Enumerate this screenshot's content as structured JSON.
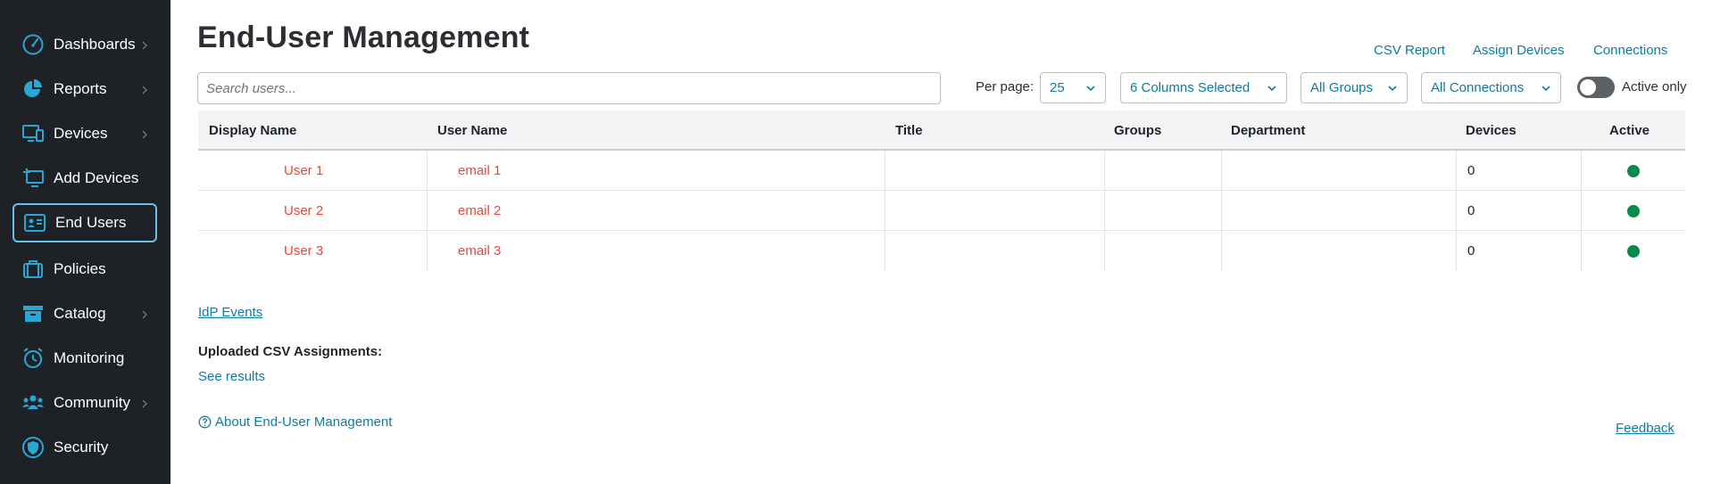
{
  "app": {
    "title": "End-User Management"
  },
  "sidebar": {
    "items": [
      {
        "label": "Dashboards",
        "icon": "dashboard-gauge-icon",
        "has_submenu": true
      },
      {
        "label": "Reports",
        "icon": "pie-chart-icon",
        "has_submenu": true
      },
      {
        "label": "Devices",
        "icon": "devices-icon",
        "has_submenu": true
      },
      {
        "label": "Add Devices",
        "icon": "add-device-icon",
        "has_submenu": false
      },
      {
        "label": "End Users",
        "icon": "id-card-icon",
        "has_submenu": false,
        "active": true
      },
      {
        "label": "Policies",
        "icon": "briefcase-icon",
        "has_submenu": false
      },
      {
        "label": "Catalog",
        "icon": "archive-box-icon",
        "has_submenu": true
      },
      {
        "label": "Monitoring",
        "icon": "alarm-clock-icon",
        "has_submenu": false
      },
      {
        "label": "Community",
        "icon": "people-icon",
        "has_submenu": true
      },
      {
        "label": "Security",
        "icon": "shield-icon",
        "has_submenu": false
      }
    ]
  },
  "header": {
    "links": {
      "csv_report": "CSV Report",
      "assign_devices": "Assign Devices",
      "connections": "Connections"
    }
  },
  "toolbar": {
    "search_placeholder": "Search users...",
    "per_page_label": "Per page:",
    "per_page_value": "25",
    "columns_select": "6 Columns Selected",
    "groups_select": "All Groups",
    "connections_select": "All Connections",
    "active_only_label": "Active only",
    "active_only_on": false
  },
  "table": {
    "columns": [
      "Display Name",
      "User Name",
      "Title",
      "Groups",
      "Department",
      "Devices",
      "Active"
    ],
    "rows": [
      {
        "display_name": "User 1",
        "user_name": "email 1",
        "title": "",
        "groups": "",
        "department": "",
        "devices": "0",
        "active": true
      },
      {
        "display_name": "User 2",
        "user_name": "email 2",
        "title": "",
        "groups": "",
        "department": "",
        "devices": "0",
        "active": true
      },
      {
        "display_name": "User 3",
        "user_name": "email 3",
        "title": "",
        "groups": "",
        "department": "",
        "devices": "0",
        "active": true
      }
    ]
  },
  "footer": {
    "idp_events": "IdP Events",
    "uploaded_csv_label": "Uploaded CSV Assignments:",
    "see_results": "See results",
    "about": "About End-User Management",
    "feedback": "Feedback"
  },
  "colors": {
    "sidebar_bg": "#1e2227",
    "icon_accent": "#2aa6d6",
    "link": "#0d7ba3",
    "user_link": "#e8473b",
    "active_dot": "#0a8a4a"
  }
}
